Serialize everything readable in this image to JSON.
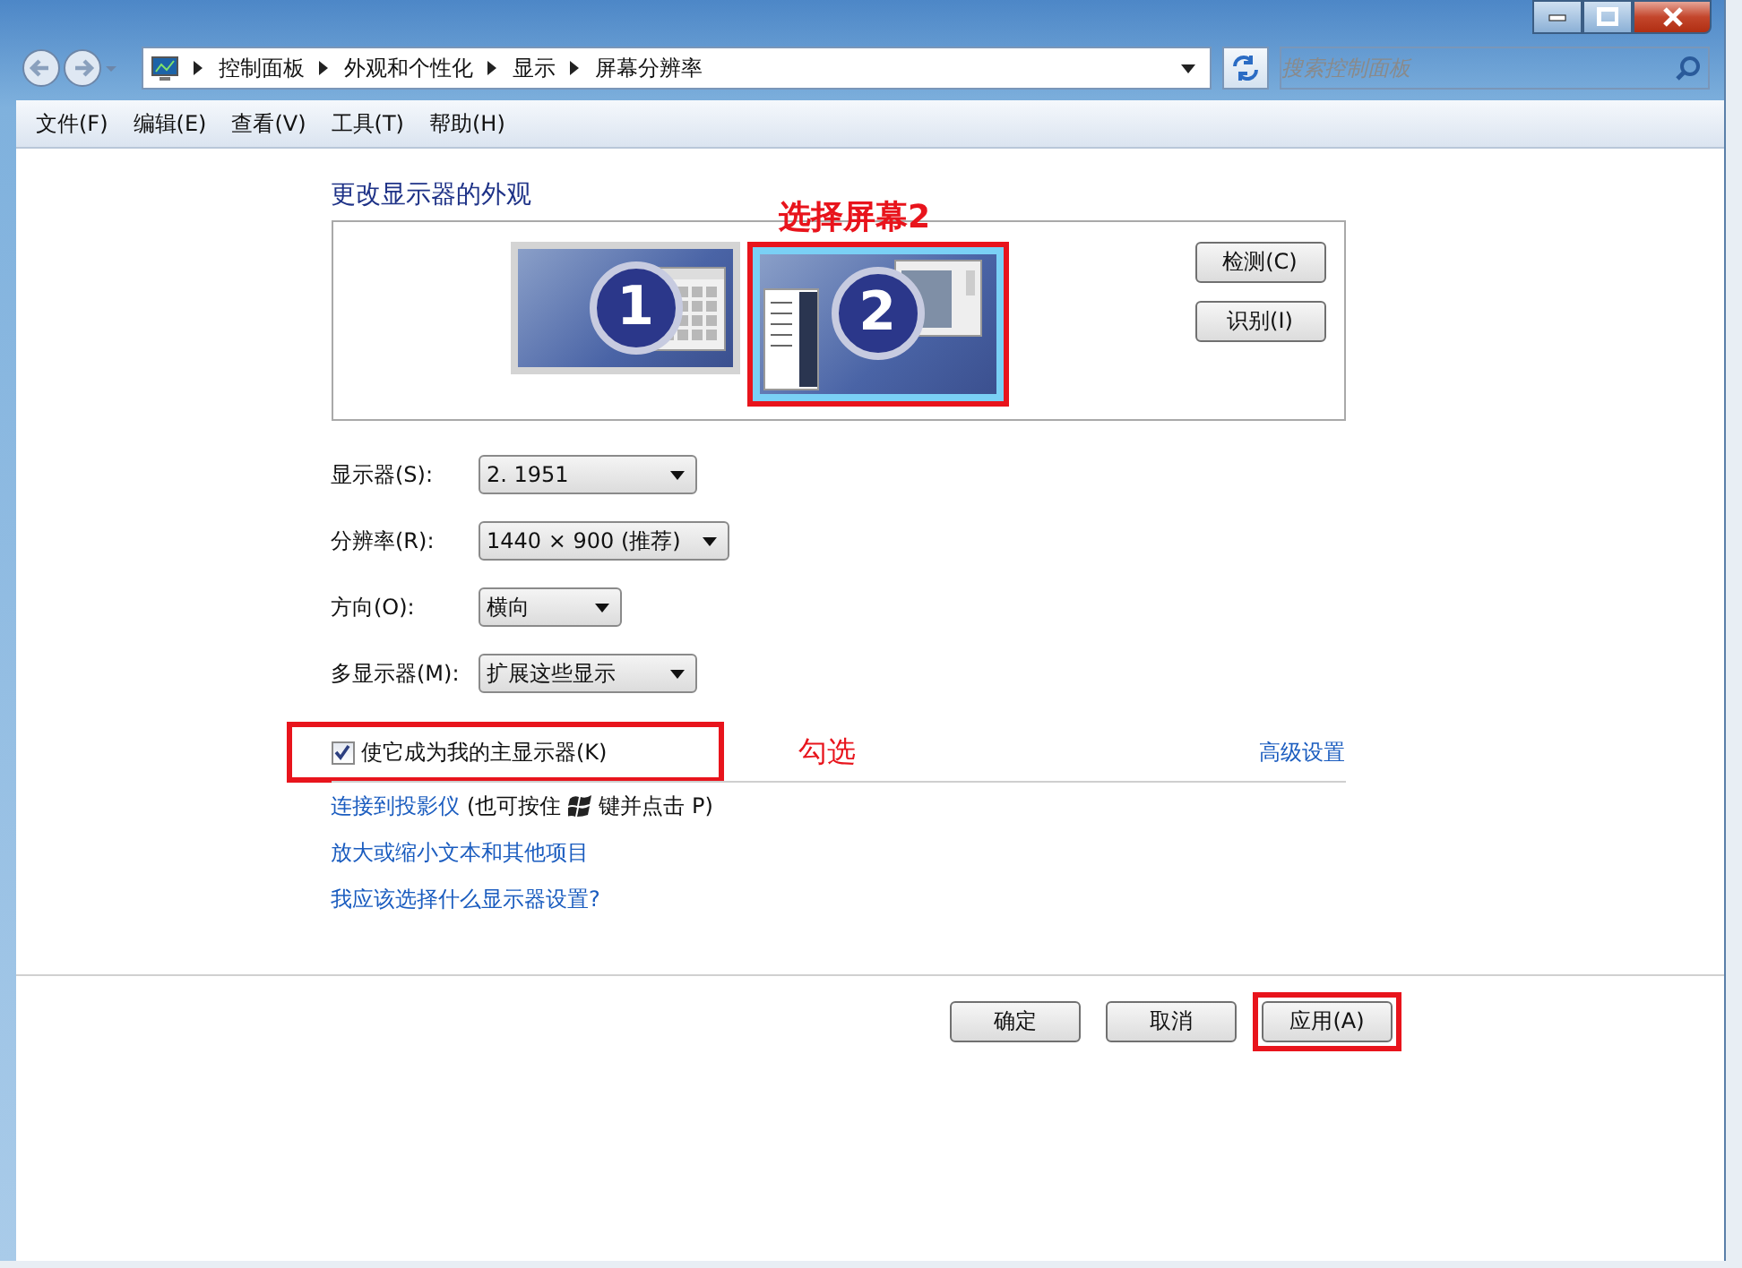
{
  "address_bar": {
    "path": [
      "控制面板",
      "外观和个性化",
      "显示",
      "屏幕分辨率"
    ]
  },
  "search": {
    "placeholder": "搜索控制面板"
  },
  "menu": [
    "文件(F)",
    "编辑(E)",
    "查看(V)",
    "工具(T)",
    "帮助(H)"
  ],
  "heading": "更改显示器的外观",
  "monitors_annotation": "选择屏幕2",
  "monitors": [
    {
      "label": "1",
      "selected": false,
      "highlighted": false
    },
    {
      "label": "2",
      "selected": true,
      "highlighted": true
    }
  ],
  "side_buttons": [
    "检测(C)",
    "识别(I)"
  ],
  "settings": [
    {
      "label": "显示器(S):",
      "value": "2. 1951"
    },
    {
      "label": "分辨率(R):",
      "value": "1440 × 900 (推荐)"
    },
    {
      "label": "方向(O):",
      "value": "横向"
    },
    {
      "label": "多显示器(M):",
      "value": "扩展这些显示"
    }
  ],
  "primary_checkbox": {
    "label": "使它成为我的主显示器(K)",
    "checked": true,
    "highlighted": true,
    "annotation": "勾选"
  },
  "advanced_link": "高级设置",
  "links": [
    {
      "text": "连接到投影仪",
      "note_before": "(也可按住",
      "note_after": "键并点击 P)"
    },
    {
      "text": "放大或缩小文本和其他项目"
    },
    {
      "text": "我应该选择什么显示器设置?"
    }
  ],
  "buttons": [
    {
      "label": "确定",
      "highlighted": false
    },
    {
      "label": "取消",
      "highlighted": false
    },
    {
      "label": "应用(A)",
      "highlighted": true
    }
  ]
}
